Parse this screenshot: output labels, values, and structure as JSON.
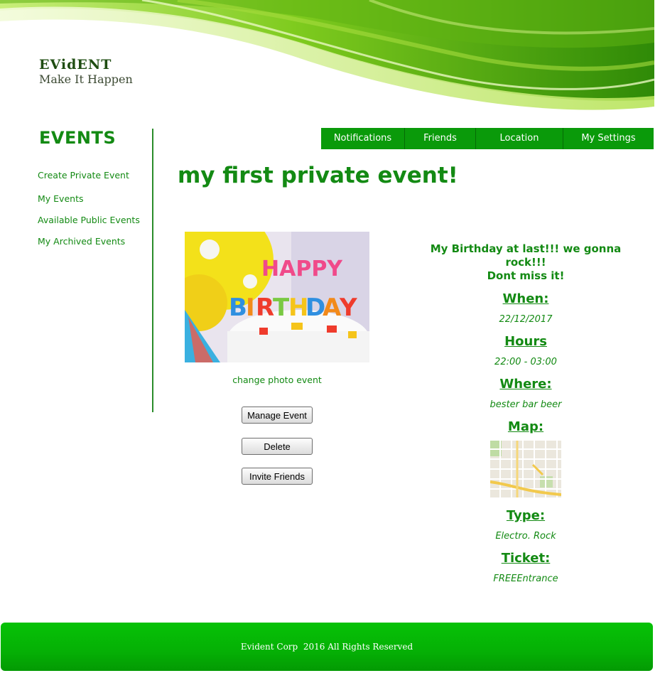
{
  "brand": {
    "name": "EVidENT",
    "tagline": "Make It Happen",
    "colors": {
      "primary_green": "#138a13",
      "nav_green": "#0a9a0a",
      "footer_green": "#05b005"
    }
  },
  "topnav": {
    "items": [
      {
        "label": "Notifications"
      },
      {
        "label": "Friends"
      },
      {
        "label": "Location"
      },
      {
        "label": "My Settings"
      }
    ]
  },
  "sidebar": {
    "title": "EVENTS",
    "items": [
      {
        "label": "Create Private Event"
      },
      {
        "label": "My Events"
      },
      {
        "label": "Available Public Events"
      },
      {
        "label": "My Archived Events"
      }
    ]
  },
  "event": {
    "title": "my first private event!",
    "photo_icon": "birthday-cake-photo",
    "change_photo": "change photo event",
    "buttons": {
      "manage": "Manage Event",
      "delete": "Delete",
      "invite": "Invite Friends"
    },
    "description_line1": "My Birthday at last!!! we gonna rock!!!",
    "description_line2": "Dont miss it!",
    "details": {
      "when_label": "When:",
      "when_value": "22/12/2017",
      "hours_label": "Hours",
      "hours_value": "22:00 - 03:00",
      "where_label": "Where:",
      "where_value": "bester bar beer",
      "map_label": "Map:",
      "map_icon": "map-thumbnail",
      "type_label": "Type:",
      "type_value": "Electro. Rock",
      "ticket_label": "Ticket:",
      "ticket_value": "FREEEntrance"
    }
  },
  "footer": {
    "text": "Evident Corp  2016 All Rights Reserved"
  }
}
